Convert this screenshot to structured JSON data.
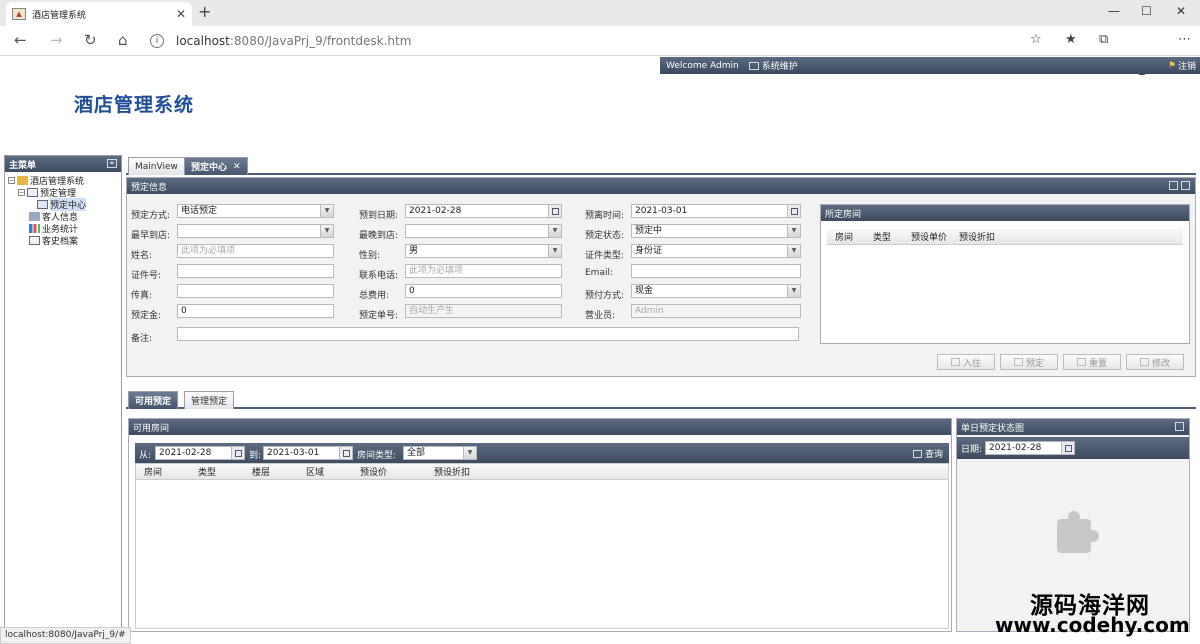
{
  "browser": {
    "tab_title": "酒店管理系统",
    "url_host": "localhost",
    "url_rest": ":8080/JavaPrj_9/frontdesk.htm"
  },
  "header": {
    "welcome": "Welcome Admin",
    "system_maintain": "系统维护",
    "logout": "注销",
    "app_title": "酒店管理系统"
  },
  "sidebar": {
    "title": "主菜单",
    "items": [
      {
        "label": "酒店管理系统"
      },
      {
        "label": "预定管理"
      },
      {
        "label": "预定中心"
      },
      {
        "label": "客人信息"
      },
      {
        "label": "业务统计"
      },
      {
        "label": "客史档案"
      }
    ]
  },
  "main_tabs": [
    {
      "label": "MainView"
    },
    {
      "label": "预定中心"
    }
  ],
  "booking": {
    "panel_title": "预定信息",
    "fields": {
      "method_label": "预定方式:",
      "method_value": "电话预定",
      "arrive_label": "预到日期:",
      "arrive_value": "2021-02-28",
      "leave_label": "预离时间:",
      "leave_value": "2021-03-01",
      "earliest_label": "最早到店:",
      "latest_label": "最晚到店:",
      "status_label": "预定状态:",
      "status_value": "预定中",
      "name_label": "姓名:",
      "name_placeholder": "此项为必填项",
      "gender_label": "性别:",
      "gender_value": "男",
      "idtype_label": "证件类型:",
      "idtype_value": "身份证",
      "idno_label": "证件号:",
      "phone_label": "联系电话:",
      "phone_placeholder": "此项为必填项",
      "email_label": "Email:",
      "fax_label": "传真:",
      "total_label": "总费用:",
      "total_value": "0",
      "pay_label": "预付方式:",
      "pay_value": "现金",
      "deposit_label": "预定金:",
      "deposit_value": "0",
      "orderno_label": "预定单号:",
      "orderno_placeholder": "自动生产生",
      "clerk_label": "营业员:",
      "clerk_value": "Admin",
      "remark_label": "备注:"
    },
    "selected_rooms": {
      "title": "所定房间",
      "columns": [
        "房间",
        "类型",
        "预设单价",
        "预设折扣"
      ]
    },
    "buttons": {
      "checkin": "入住",
      "book": "预定",
      "reset": "重置",
      "modify": "修改"
    }
  },
  "lower_tabs": [
    {
      "label": "可用预定"
    },
    {
      "label": "管理预定"
    }
  ],
  "available": {
    "title": "可用房间",
    "from_label": "从:",
    "from_value": "2021-02-28",
    "to_label": "到:",
    "to_value": "2021-03-01",
    "roomtype_label": "房间类型:",
    "roomtype_value": "全部",
    "query": "查询",
    "columns": [
      "房间",
      "类型",
      "楼层",
      "区域",
      "预设价",
      "预设折扣"
    ]
  },
  "daily": {
    "title": "单日预定状态图",
    "date_label": "日期:",
    "date_value": "2021-02-28"
  },
  "status_bar": "localhost:8080/JavaPrj_9/#",
  "watermark": {
    "line1": "源码海洋网",
    "line2": "www.codehy.com"
  }
}
